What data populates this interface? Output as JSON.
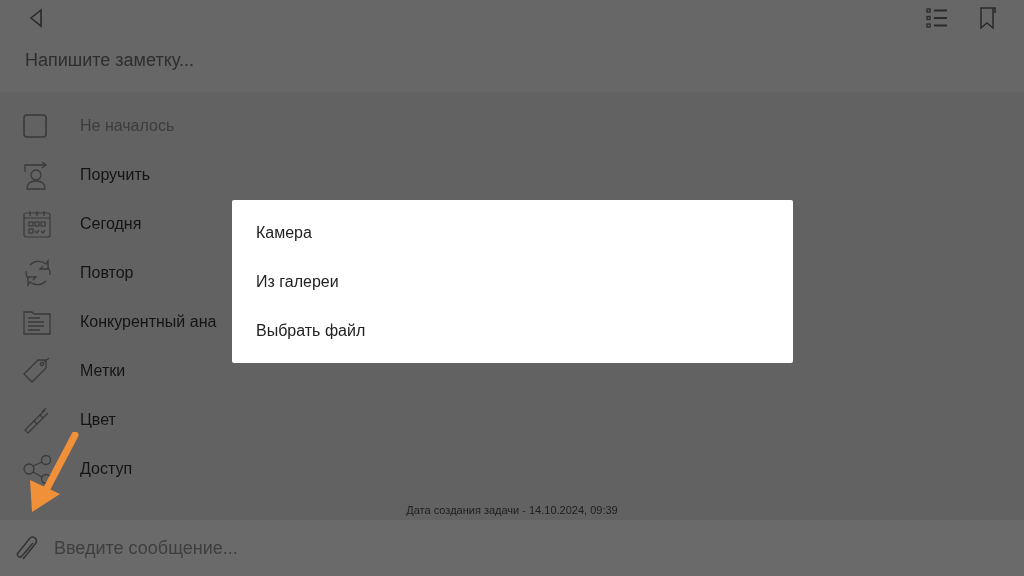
{
  "note_field": {
    "placeholder": "Напишите заметку..."
  },
  "items": [
    {
      "kind": "checkbox",
      "label": "Не началось",
      "checked": false
    },
    {
      "kind": "assign",
      "label": "Поручить"
    },
    {
      "kind": "calendar",
      "label": "Сегодня"
    },
    {
      "kind": "repeat",
      "label": "Повтор"
    },
    {
      "kind": "folder",
      "label": "Конкурентный ана"
    },
    {
      "kind": "tag",
      "label": "Метки"
    },
    {
      "kind": "brush",
      "label": "Цвет"
    },
    {
      "kind": "share",
      "label": "Доступ"
    }
  ],
  "created": "Дата создания задачи - 14.10.2024, 09:39",
  "message_field": {
    "placeholder": "Введите сообщение..."
  },
  "attach_menu": {
    "options": [
      "Камера",
      "Из галереи",
      "Выбрать файл"
    ]
  }
}
